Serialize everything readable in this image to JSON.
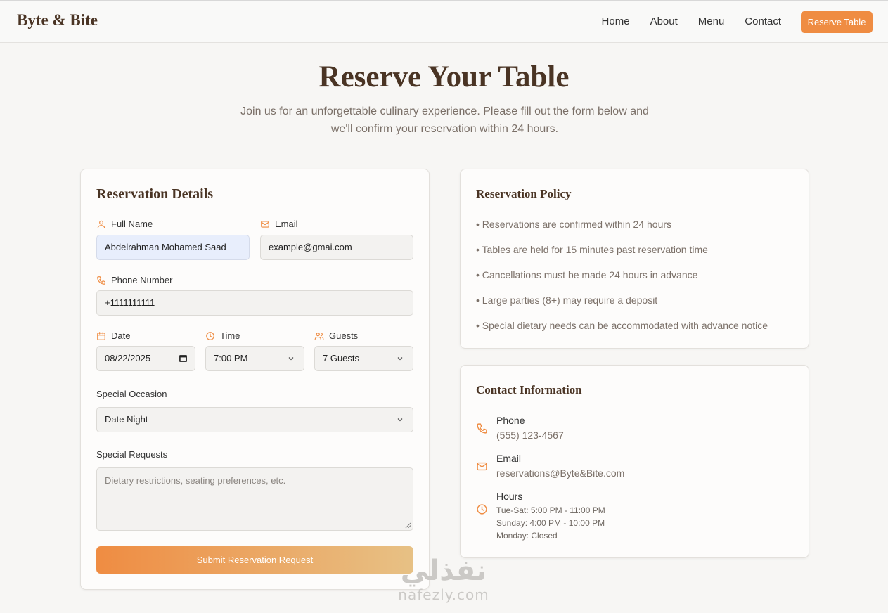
{
  "nav": {
    "brand": "Byte & Bite",
    "links": [
      "Home",
      "About",
      "Menu",
      "Contact"
    ],
    "cta": "Reserve Table"
  },
  "hero": {
    "title": "Reserve Your Table",
    "subtitle_line1": "Join us for an unforgettable culinary experience. Please fill out the form below and",
    "subtitle_line2": "we'll confirm your reservation within 24 hours."
  },
  "form": {
    "title": "Reservation Details",
    "full_name": {
      "label": "Full Name",
      "value": "Abdelrahman Mohamed Saad"
    },
    "email": {
      "label": "Email",
      "value": "example@gmai.com"
    },
    "phone": {
      "label": "Phone Number",
      "value": "+1111111111"
    },
    "date": {
      "label": "Date",
      "value": "08/22/2025"
    },
    "time": {
      "label": "Time",
      "value": "7:00 PM"
    },
    "guests": {
      "label": "Guests",
      "value": "7 Guests"
    },
    "occasion": {
      "label": "Special Occasion",
      "value": "Date Night"
    },
    "requests": {
      "label": "Special Requests",
      "placeholder": "Dietary restrictions, seating preferences, etc."
    },
    "submit": "Submit Reservation Request"
  },
  "policy": {
    "title": "Reservation Policy",
    "items": [
      "• Reservations are confirmed within 24 hours",
      "• Tables are held for 15 minutes past reservation time",
      "• Cancellations must be made 24 hours in advance",
      "• Large parties (8+) may require a deposit",
      "• Special dietary needs can be accommodated with advance notice"
    ]
  },
  "contact": {
    "title": "Contact Information",
    "phone": {
      "label": "Phone",
      "value": "(555) 123-4567"
    },
    "email": {
      "label": "Email",
      "value": "reservations@Byte&Bite.com"
    },
    "hours": {
      "label": "Hours",
      "lines": [
        "Tue-Sat: 5:00 PM - 11:00 PM",
        "Sunday: 4:00 PM - 10:00 PM",
        "Monday: Closed"
      ]
    }
  },
  "watermark": {
    "arabic": "نفذلي",
    "latin": "nafezly.com"
  },
  "colors": {
    "accent": "#ef8c42",
    "brand": "#4a3424",
    "muted": "#7b7068"
  },
  "icons": [
    "user-icon",
    "mail-icon",
    "phone-icon",
    "calendar-icon",
    "clock-icon",
    "users-icon",
    "chevron-down-icon"
  ]
}
